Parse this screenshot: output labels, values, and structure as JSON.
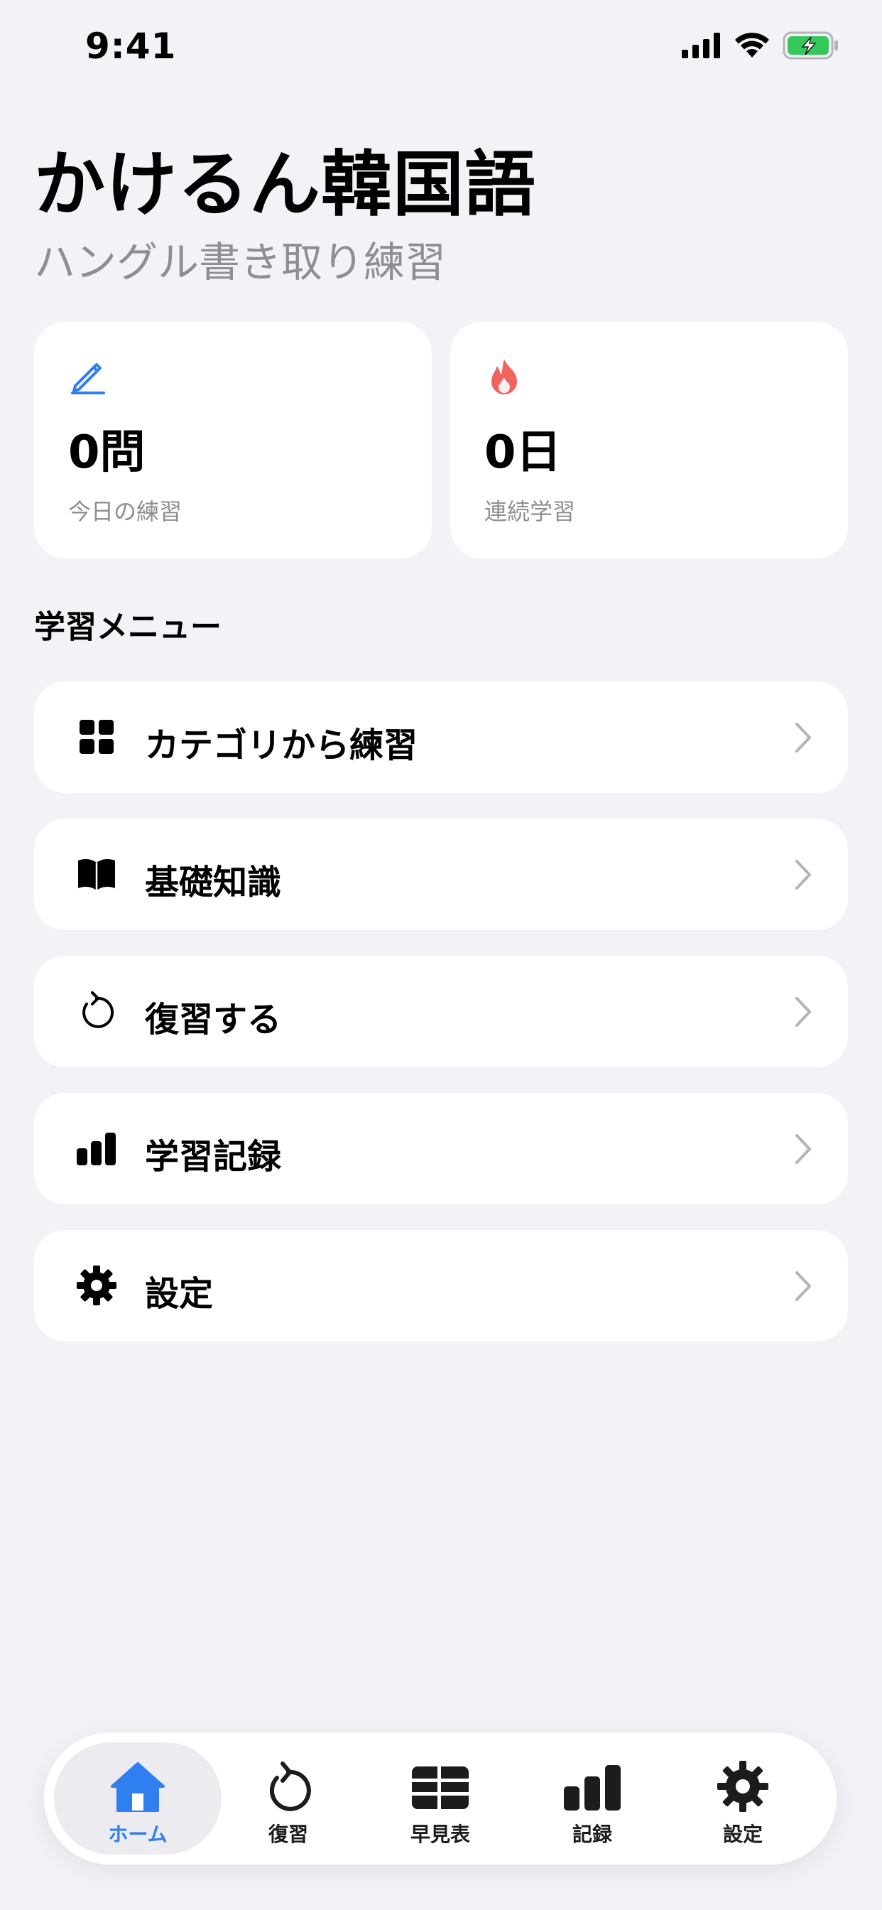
{
  "status_bar": {
    "time": "9:41"
  },
  "header": {
    "title": "かけるん韓国語",
    "subtitle": "ハングル書き取り練習"
  },
  "stats": [
    {
      "icon": "pencil-icon",
      "value": "0問",
      "label": "今日の練習",
      "color": "#2f7ff0"
    },
    {
      "icon": "flame-icon",
      "value": "0日",
      "label": "連続学習",
      "color": "#f2625e"
    }
  ],
  "menu": {
    "section_title": "学習メニュー",
    "items": [
      {
        "icon": "grid-icon",
        "label": "カテゴリから練習"
      },
      {
        "icon": "book-icon",
        "label": "基礎知識"
      },
      {
        "icon": "replay-icon",
        "label": "復習する"
      },
      {
        "icon": "bar-chart-icon",
        "label": "学習記録"
      },
      {
        "icon": "gear-icon",
        "label": "設定"
      }
    ]
  },
  "tab_bar": {
    "active": "ホーム",
    "items": [
      {
        "icon": "house-icon",
        "label": "ホーム"
      },
      {
        "icon": "replay-icon",
        "label": "復習"
      },
      {
        "icon": "table-icon",
        "label": "早見表"
      },
      {
        "icon": "bar-chart-icon",
        "label": "記録"
      },
      {
        "icon": "gear-icon",
        "label": "設定"
      }
    ]
  },
  "colors": {
    "accent": "#2f7ff0",
    "flame": "#f2625e",
    "background": "#f2f2f7",
    "secondary_text": "#8e8e93",
    "battery": "#34c759"
  }
}
